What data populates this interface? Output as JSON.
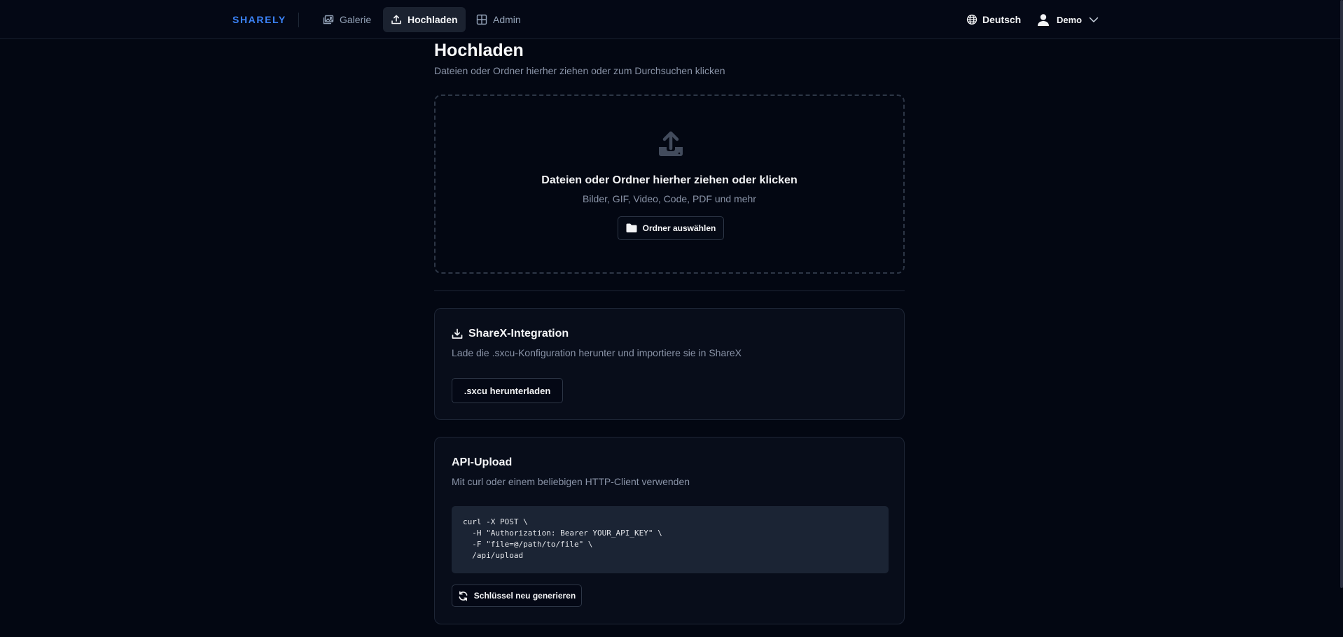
{
  "header": {
    "brand": "SHARELY",
    "nav": [
      {
        "label": "Galerie",
        "icon": "gallery-icon"
      },
      {
        "label": "Hochladen",
        "icon": "upload-icon",
        "active": true
      },
      {
        "label": "Admin",
        "icon": "grid-icon"
      }
    ],
    "language": "Deutsch",
    "user": "Demo"
  },
  "page": {
    "title": "Hochladen",
    "subtitle": "Dateien oder Ordner hierher ziehen oder zum Durchsuchen klicken"
  },
  "dropzone": {
    "title": "Dateien oder Ordner hierher ziehen oder klicken",
    "subtitle": "Bilder, GIF, Video, Code, PDF und mehr",
    "button_label": "Ordner auswählen"
  },
  "sharex": {
    "title": "ShareX-Integration",
    "description": "Lade die .sxcu-Konfiguration herunter und importiere sie in ShareX",
    "button_label": ".sxcu herunterladen"
  },
  "api": {
    "title": "API-Upload",
    "description": "Mit curl oder einem beliebigen HTTP-Client verwenden",
    "code": "curl -X POST \\\n  -H \"Authorization: Bearer YOUR_API_KEY\" \\\n  -F \"file=@/path/to/file\" \\\n  /api/upload",
    "button_label": "Schlüssel neu generieren"
  },
  "colors": {
    "background": "#030712",
    "accent": "#3b82f6",
    "muted_text": "#8a94a8",
    "border": "#1e2636",
    "code_background": "#1b2434"
  }
}
